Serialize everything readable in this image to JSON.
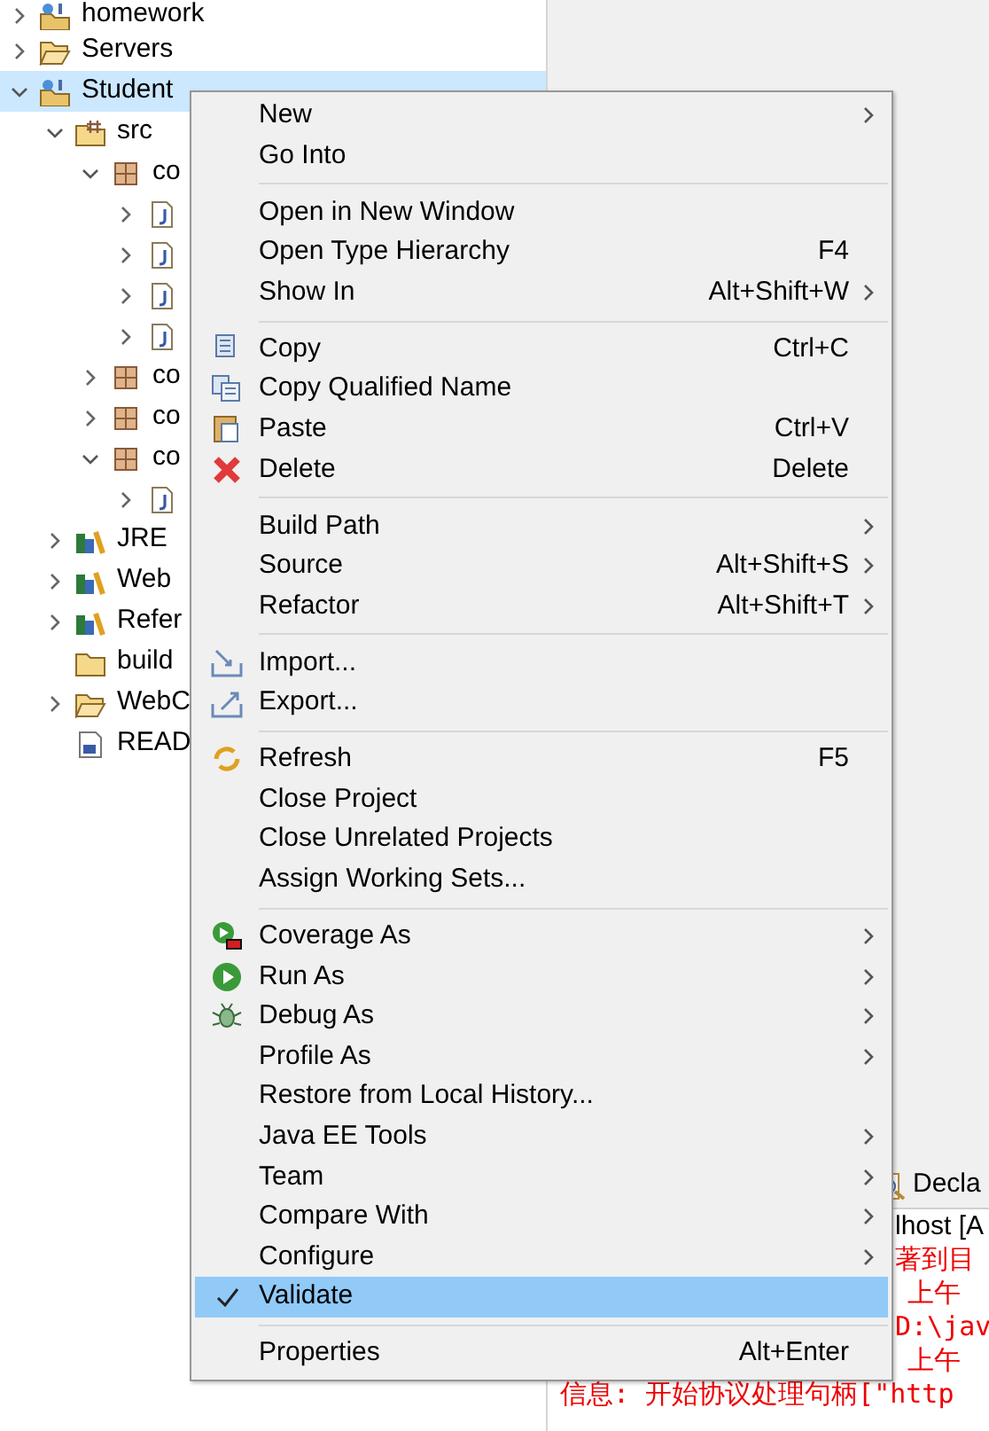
{
  "tree": [
    {
      "label": "homework",
      "kind": "project",
      "expanded": false,
      "selected": false
    },
    {
      "label": "Servers",
      "kind": "openfolder",
      "expanded": false,
      "selected": false
    },
    {
      "label": "Student",
      "kind": "project",
      "expanded": true,
      "selected": true,
      "children": [
        {
          "label": "src",
          "kind": "source",
          "expanded": true,
          "selected": false,
          "children": [
            {
              "label": "co",
              "kind": "package",
              "expanded": true,
              "selected": false,
              "children": [
                {
                  "kind": "javafile",
                  "expanded": false,
                  "selected": false
                },
                {
                  "kind": "javafile",
                  "expanded": false,
                  "selected": false
                },
                {
                  "kind": "javafile",
                  "expanded": false,
                  "selected": false
                },
                {
                  "kind": "javafile",
                  "expanded": false,
                  "selected": false
                }
              ]
            },
            {
              "label": "co",
              "kind": "package",
              "expanded": false,
              "selected": false
            },
            {
              "label": "co",
              "kind": "package",
              "expanded": false,
              "selected": false
            },
            {
              "label": "co",
              "kind": "package",
              "expanded": true,
              "selected": false,
              "children": [
                {
                  "kind": "javafile",
                  "expanded": false,
                  "selected": false
                }
              ]
            }
          ]
        },
        {
          "label": "JRE",
          "kind": "library",
          "expanded": false,
          "selected": false
        },
        {
          "label": "Web",
          "kind": "library",
          "expanded": false,
          "selected": false
        },
        {
          "label": "Refer",
          "kind": "library",
          "expanded": false,
          "selected": false
        },
        {
          "label": "build",
          "kind": "folder",
          "selected": false
        },
        {
          "label": "WebC",
          "kind": "openfolder",
          "expanded": false,
          "selected": false
        },
        {
          "label": "READ",
          "kind": "document",
          "selected": false
        }
      ]
    }
  ],
  "context_menu": {
    "groups": [
      [
        {
          "label": "New",
          "submenu": true,
          "checked": false,
          "selected": false
        },
        {
          "label": "Go Into",
          "submenu": false,
          "checked": false,
          "selected": false
        }
      ],
      [
        {
          "label": "Open in New Window",
          "submenu": false,
          "checked": false,
          "selected": false
        },
        {
          "label": "Open Type Hierarchy",
          "shortcut": "F4",
          "submenu": false,
          "checked": false,
          "selected": false
        },
        {
          "label": "Show In",
          "shortcut": "Alt+Shift+W",
          "submenu": true,
          "checked": false,
          "selected": false
        }
      ],
      [
        {
          "label": "Copy",
          "kind": "copy",
          "shortcut": "Ctrl+C",
          "submenu": false,
          "checked": false,
          "selected": false
        },
        {
          "label": "Copy Qualified Name",
          "kind": "copyname",
          "submenu": false,
          "checked": false,
          "selected": false
        },
        {
          "label": "Paste",
          "kind": "paste",
          "shortcut": "Ctrl+V",
          "submenu": false,
          "checked": false,
          "selected": false
        },
        {
          "label": "Delete",
          "kind": "delete",
          "shortcut": "Delete",
          "submenu": false,
          "checked": false,
          "selected": false
        }
      ],
      [
        {
          "label": "Build Path",
          "submenu": true,
          "checked": false,
          "selected": false
        },
        {
          "label": "Source",
          "shortcut": "Alt+Shift+S",
          "submenu": true,
          "checked": false,
          "selected": false
        },
        {
          "label": "Refactor",
          "shortcut": "Alt+Shift+T",
          "submenu": true,
          "checked": false,
          "selected": false
        }
      ],
      [
        {
          "label": "Import...",
          "kind": "import",
          "submenu": false,
          "checked": false,
          "selected": false
        },
        {
          "label": "Export...",
          "kind": "export",
          "submenu": false,
          "checked": false,
          "selected": false
        }
      ],
      [
        {
          "label": "Refresh",
          "kind": "refresh",
          "shortcut": "F5",
          "submenu": false,
          "checked": false,
          "selected": false
        },
        {
          "label": "Close Project",
          "submenu": false,
          "checked": false,
          "selected": false
        },
        {
          "label": "Close Unrelated Projects",
          "submenu": false,
          "checked": false,
          "selected": false
        },
        {
          "label": "Assign Working Sets...",
          "submenu": false,
          "checked": false,
          "selected": false
        }
      ],
      [
        {
          "label": "Coverage As",
          "kind": "coverage",
          "submenu": true,
          "checked": false,
          "selected": false
        },
        {
          "label": "Run As",
          "kind": "run",
          "submenu": true,
          "checked": false,
          "selected": false
        },
        {
          "label": "Debug As",
          "kind": "debug",
          "submenu": true,
          "checked": false,
          "selected": false
        },
        {
          "label": "Profile As",
          "submenu": true,
          "checked": false,
          "selected": false
        },
        {
          "label": "Restore from Local History...",
          "submenu": false,
          "checked": false,
          "selected": false
        },
        {
          "label": "Java EE Tools",
          "submenu": true,
          "checked": false,
          "selected": false
        },
        {
          "label": "Team",
          "submenu": true,
          "checked": false,
          "selected": false
        },
        {
          "label": "Compare With",
          "submenu": true,
          "checked": false,
          "selected": false
        },
        {
          "label": "Configure",
          "submenu": true,
          "checked": false,
          "selected": false
        },
        {
          "label": "Validate",
          "submenu": false,
          "checked": true,
          "selected": true
        }
      ],
      [
        {
          "label": "Properties",
          "shortcut": "Alt+Enter",
          "submenu": false,
          "checked": false,
          "selected": false
        }
      ]
    ]
  },
  "console": {
    "tab": "Decla",
    "title": "lhost [A",
    "lines": [
      "著到目",
      "上午",
      "D:\\jav",
      "上午",
      "信息: 开始协议处理句柄[\"http"
    ]
  }
}
